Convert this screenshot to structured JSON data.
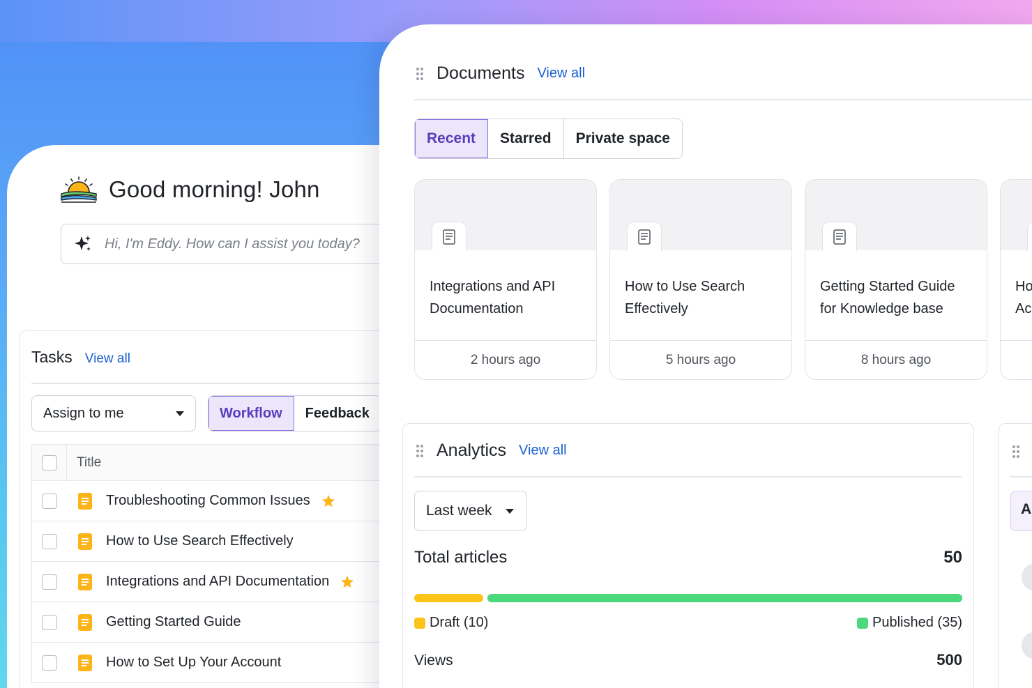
{
  "greeting": {
    "text": "Good morning! John",
    "icon": "sunrise-icon"
  },
  "assistant": {
    "placeholder": "Hi, I'm Eddy. How can I assist you today?",
    "icon": "sparkles-icon"
  },
  "tasks": {
    "title": "Tasks",
    "view_all": "View all",
    "filter": {
      "selected": "Assign to me"
    },
    "tabs": [
      {
        "label": "Workflow",
        "active": true
      },
      {
        "label": "Feedback",
        "active": false
      }
    ],
    "table": {
      "column_title": "Title",
      "rows": [
        {
          "title": "Troubleshooting Common Issues",
          "starred": true
        },
        {
          "title": "How to Use Search Effectively",
          "starred": false
        },
        {
          "title": "Integrations and API Documentation",
          "starred": true
        },
        {
          "title": "Getting Started Guide",
          "starred": false
        },
        {
          "title": "How to Set Up Your Account",
          "starred": false
        }
      ]
    }
  },
  "documents": {
    "title": "Documents",
    "view_all": "View all",
    "tabs": [
      {
        "label": "Recent",
        "active": true
      },
      {
        "label": "Starred",
        "active": false
      },
      {
        "label": "Private space",
        "active": false
      }
    ],
    "cards": [
      {
        "name": "Integrations and API Documentation",
        "time": "2 hours ago"
      },
      {
        "name": "How to Use Search Effectively",
        "time": "5 hours ago"
      },
      {
        "name": "Getting Started Guide for Knowledge base",
        "time": "8 hours ago"
      },
      {
        "name": "Ho Ac",
        "time": ""
      }
    ]
  },
  "analytics": {
    "title": "Analytics",
    "view_all": "View all",
    "range": "Last week",
    "total_articles_label": "Total articles",
    "total_articles_value": "50",
    "draft_label": "Draft (10)",
    "published_label": "Published (35)",
    "draft_count": 10,
    "published_count": 35,
    "views_label": "Views",
    "views_value": "500"
  },
  "side_card": {
    "tab_label": "Al"
  },
  "colors": {
    "accent": "#5b3bbd",
    "link": "#1a5fd1",
    "draft": "#fcc419",
    "published": "#4cd97b",
    "star": "#fcb419",
    "doc_icon": "#fcb419"
  }
}
